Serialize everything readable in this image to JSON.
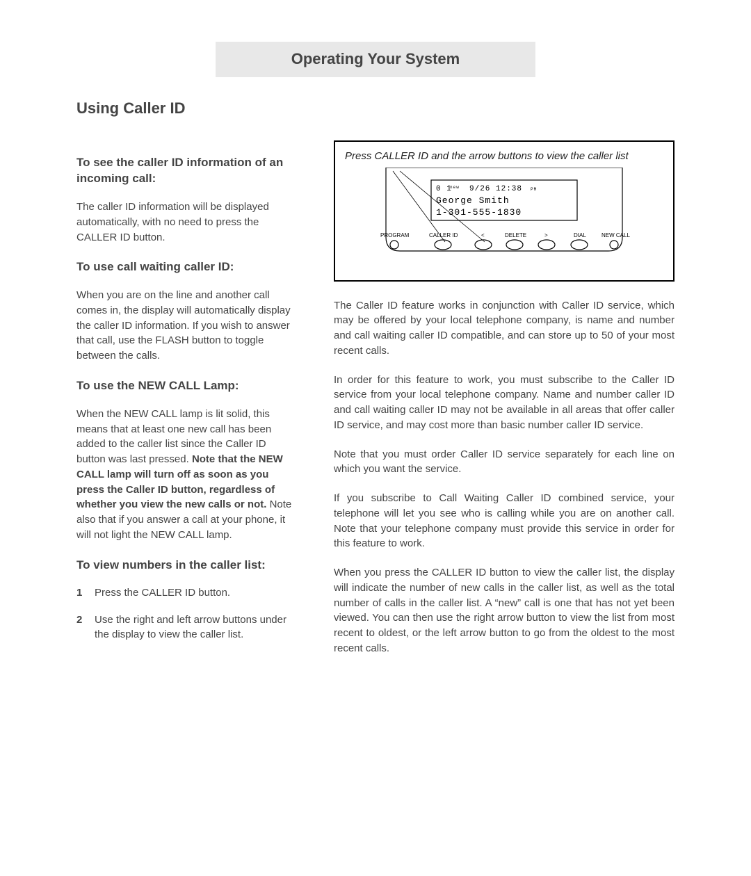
{
  "header": {
    "title": "Operating Your System"
  },
  "main_title": "Using Caller ID",
  "left": {
    "sec1": {
      "heading": "To see the caller ID information of an incoming call:",
      "body": "The caller ID information will be displayed automatically, with no need to press the CALLER ID button."
    },
    "sec2": {
      "heading": "To use call waiting caller ID:",
      "body": "When you are on the line and another call comes in, the display will automatically display the caller ID information.  If you wish to answer that call, use the FLASH button to toggle between the calls."
    },
    "sec3": {
      "heading": "To use the NEW CALL Lamp:",
      "body_pre": "When the NEW CALL lamp is lit solid, this means that at least one new call has been added to the caller list since the Caller ID button was last pressed.  ",
      "body_bold": "Note that the NEW CALL lamp will turn off as soon as you press the Caller ID button, regardless of whether you view the new calls or not.",
      "body_post": "  Note also that if you answer a call at your phone, it will not light the NEW CALL lamp."
    },
    "sec4": {
      "heading": "To view numbers in the caller list:",
      "items": [
        {
          "num": "1",
          "text": "Press the CALLER ID button."
        },
        {
          "num": "2",
          "text": "Use the right and left arrow buttons under the display to view the caller list."
        }
      ]
    }
  },
  "device": {
    "caption": "Press CALLER ID and the arrow buttons to view the caller list",
    "lcd": {
      "line1_a": "0 1",
      "line1_b": "new",
      "line1_c": "9/26 12:38",
      "line1_d": "PM",
      "line2": "George Smith",
      "line3": "1-301-555-1830"
    },
    "buttons": {
      "program": "PROGRAM",
      "callerid": "CALLER ID",
      "left": "<",
      "delete": "DELETE",
      "right": ">",
      "dial": "DIAL",
      "newcall": "NEW CALL"
    }
  },
  "right": {
    "p1": "The Caller ID feature works in conjunction with Caller ID service, which may be offered by your local telephone company, is name and number and call waiting caller ID compatible, and can store up to 50 of your most recent calls.",
    "p2": "In order for this feature to work, you must subscribe to the Caller ID service from your local telephone company.  Name and number caller ID and call waiting caller ID may not be available in all areas that offer caller ID service, and  may cost more than basic number caller ID service.",
    "p3": "Note that you must order Caller ID service separately for each line on which you want the service.",
    "p4": "If you subscribe to Call Waiting Caller ID combined service, your telephone will let you see who is calling while you are on another call.  Note that your telephone company must provide this service in order for this feature to work.",
    "p5": "When you press the CALLER ID button to view the caller list, the display will indicate the number of new calls in the caller list, as well as the total number of calls in the caller list.  A “new” call is one that has not yet been viewed.  You can then use the right arrow button to view the list from most recent to oldest, or the left arrow button to go from the oldest to the most recent calls."
  }
}
